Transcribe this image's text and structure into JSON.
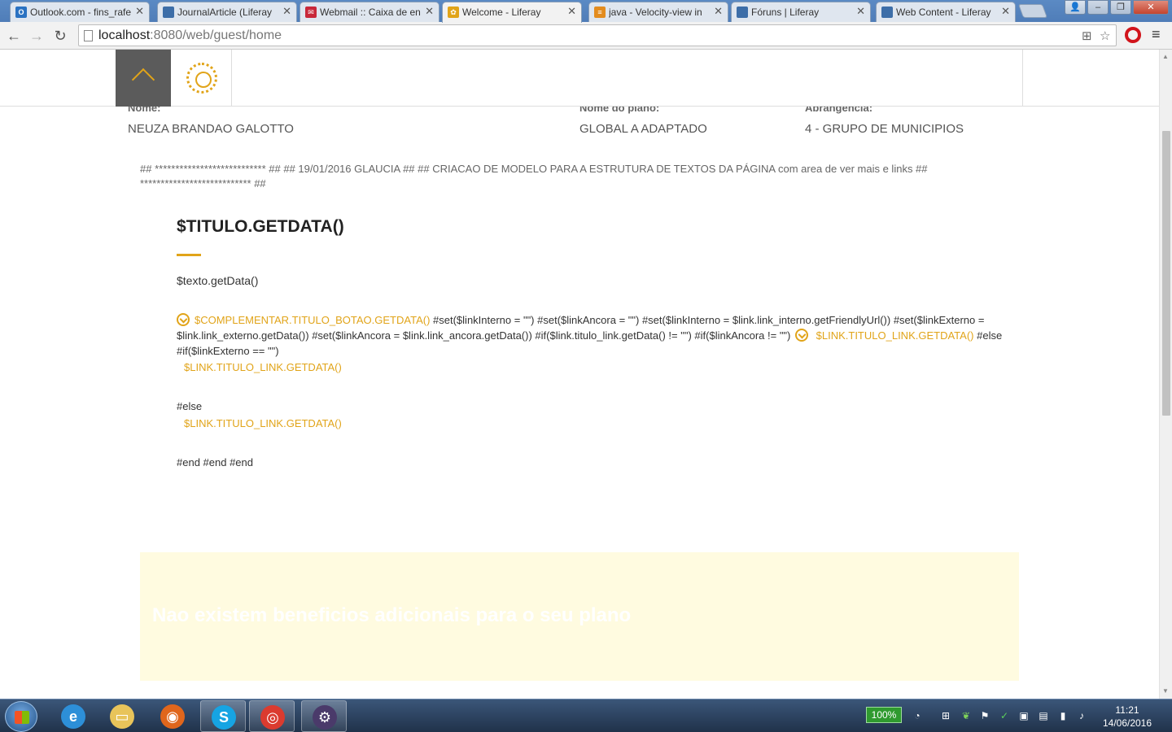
{
  "browser": {
    "tabs": [
      {
        "label": "Outlook.com - fins_rafe",
        "icon": "outlook-icon",
        "color": "#2a72c2",
        "glyph": "O"
      },
      {
        "label": "JournalArticle (Liferay",
        "icon": "liferay-doc-icon",
        "color": "#3d6ea8",
        "glyph": ""
      },
      {
        "label": "Webmail :: Caixa de en",
        "icon": "webmail-icon",
        "color": "#c8283a",
        "glyph": "✉"
      },
      {
        "label": "Welcome - Liferay",
        "icon": "liferay-flower-icon",
        "color": "#e1a419",
        "glyph": "✿"
      },
      {
        "label": "java - Velocity-view in",
        "icon": "stackoverflow-icon",
        "color": "#e38c1f",
        "glyph": "≡"
      },
      {
        "label": "Fóruns | Liferay",
        "icon": "liferay-doc-icon",
        "color": "#3d6ea8",
        "glyph": ""
      },
      {
        "label": "Web Content - Liferay",
        "icon": "liferay-doc-icon",
        "color": "#3d6ea8",
        "glyph": ""
      }
    ],
    "active_tab": 3,
    "url_host": "localhost",
    "url_path": ":8080/web/guest/home"
  },
  "header": {
    "back_to_top_icon": "chevron-up-icon",
    "logo_icon": "liferay-flower-icon"
  },
  "profile": {
    "name_label": "Nome:",
    "name_value": "NEUZA BRANDAO GALOTTO",
    "plan_label": "Nome do plano:",
    "plan_value": "GLOBAL A ADAPTADO",
    "scope_label": "Abrangencia:",
    "scope_value": "4 - GRUPO DE MUNICIPIOS"
  },
  "template": {
    "comment": "## *************************** ## ## 19/01/2016 GLAUCIA ## ## CRIACAO DE MODELO PARA A ESTRUTURA DE TEXTOS DA PÁGINA com area de ver mais e links ## *************************** ##",
    "title": "$TITULO.GETDATA()",
    "text": "$texto.getData()",
    "button_label": "$COMPLEMENTAR.TITULO_BOTAO.GETDATA()",
    "code_part1": "#set($linkInterno = \"\") #set($linkAncora = \"\") #set($linkInterno = $link.link_interno.getFriendlyUrl()) #set($linkExterno = $link.link_externo.getData()) #set($linkAncora = $link.link_ancora.getData()) #if($link.titulo_link.getData() != \"\") #if($linkAncora != \"\")",
    "link_inline": "$LINK.TITULO_LINK.GETDATA()",
    "code_part2": "#else #if($linkExterno == \"\")",
    "link_1": "$LINK.TITULO_LINK.GETDATA()",
    "else_text": "#else",
    "link_2": "$LINK.TITULO_LINK.GETDATA()",
    "end_text": "#end #end #end"
  },
  "benefits": {
    "message": "Nao existem beneficios adicionais para o seu plano"
  },
  "taskbar": {
    "apps": [
      {
        "name": "internet-explorer-icon",
        "color": "#2d8fd8",
        "glyph": "e",
        "running": false
      },
      {
        "name": "file-explorer-icon",
        "color": "#e8c45a",
        "glyph": "▭",
        "running": false
      },
      {
        "name": "firefox-icon",
        "color": "#e0661c",
        "glyph": "◉",
        "running": false
      },
      {
        "name": "skype-icon",
        "color": "#16a4e3",
        "glyph": "S",
        "running": true
      },
      {
        "name": "chrome-icon",
        "color": "#db3b2f",
        "glyph": "◎",
        "running": true
      },
      {
        "name": "eclipse-javaee-icon",
        "color": "#4a3a6a",
        "glyph": "⚙",
        "running": true
      }
    ],
    "battery": "100%",
    "time": "11:21",
    "date": "14/06/2016"
  }
}
